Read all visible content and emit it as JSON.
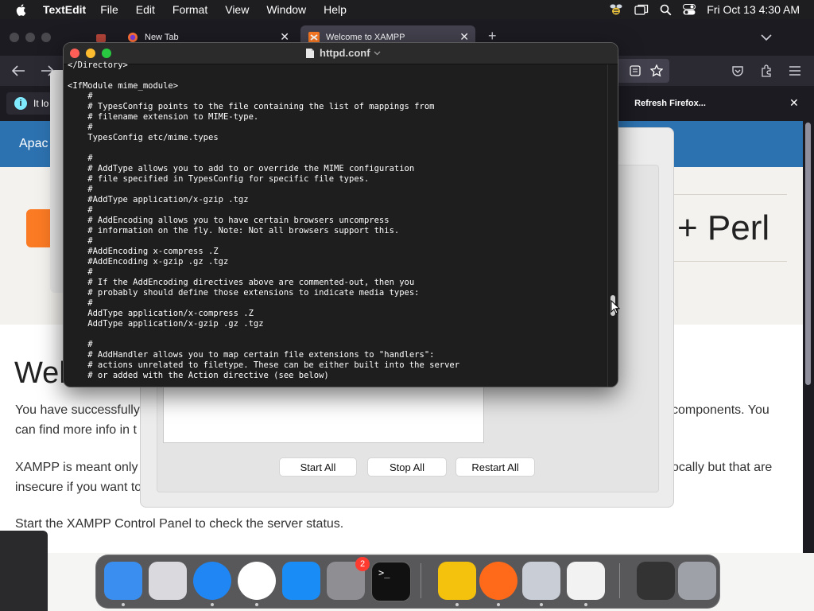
{
  "menubar": {
    "app_name": "TextEdit",
    "items": [
      "File",
      "Edit",
      "Format",
      "View",
      "Window",
      "Help"
    ],
    "clock": "Fri Oct 13  4:30 AM"
  },
  "firefox": {
    "tabs": [
      {
        "label": "New Tab"
      },
      {
        "label": "Welcome to XAMPP"
      }
    ],
    "notification": {
      "text_fragment": "It lo",
      "refresh_button": "Refresh Firefox..."
    },
    "page": {
      "header_brand": "Apac",
      "hero_title_fragment": "+ Perl",
      "welcome_heading": "Wel",
      "para1_left_line1": "You have successfully",
      "para1_left_line2": "can find more info in t",
      "para1_right": "components. You",
      "para2_left_line1": "XAMPP is meant only",
      "para2_left_line2": "insecure if you want to",
      "para2_right": "ocally but that are",
      "para3": "Start the XAMPP Control Panel to check the server status."
    }
  },
  "xampp_panel": {
    "buttons": {
      "start_all": "Start All",
      "stop_all": "Stop All",
      "restart_all": "Restart All"
    }
  },
  "textedit": {
    "title": "httpd.conf",
    "lines": [
      "</Directory>",
      "",
      "<IfModule mime_module>",
      "    #",
      "    # TypesConfig points to the file containing the list of mappings from",
      "    # filename extension to MIME-type.",
      "    #",
      "    TypesConfig etc/mime.types",
      "",
      "    #",
      "    # AddType allows you to add to or override the MIME configuration",
      "    # file specified in TypesConfig for specific file types.",
      "    #",
      "    #AddType application/x-gzip .tgz",
      "    #",
      "    # AddEncoding allows you to have certain browsers uncompress",
      "    # information on the fly. Note: Not all browsers support this.",
      "    #",
      "    #AddEncoding x-compress .Z",
      "    #AddEncoding x-gzip .gz .tgz",
      "    #",
      "    # If the AddEncoding directives above are commented-out, then you",
      "    # probably should define those extensions to indicate media types:",
      "    #",
      "    AddType application/x-compress .Z",
      "    AddType application/x-gzip .gz .tgz",
      "",
      "    #",
      "    # AddHandler allows you to map certain file extensions to \"handlers\":",
      "    # actions unrelated to filetype. These can be either built into the server",
      "    # or added with the Action directive (see below)"
    ]
  },
  "dock": {
    "apps": [
      {
        "name": "Finder",
        "icon": "finder-icon",
        "color": "#3a8ef0"
      },
      {
        "name": "Launchpad",
        "icon": "launchpad-icon",
        "color": "#d9d9de"
      },
      {
        "name": "Safari",
        "icon": "safari-icon",
        "color": "#1f86f3"
      },
      {
        "name": "Chrome",
        "icon": "chrome-icon",
        "color": "#ffffff"
      },
      {
        "name": "App Store",
        "icon": "app-store-icon",
        "color": "#1a8cf6"
      },
      {
        "name": "System Settings",
        "icon": "settings-icon",
        "color": "#8e8e93",
        "badge": "2"
      },
      {
        "name": "Terminal",
        "icon": "terminal-icon",
        "color": "#111111"
      },
      {
        "name": "XAMPP Manager",
        "icon": "xampp-bee-icon",
        "color": "#f4c20d"
      },
      {
        "name": "Firefox",
        "icon": "firefox-icon",
        "color": "#ff6a1a"
      },
      {
        "name": "Gear Utility",
        "icon": "gear-app-icon",
        "color": "#c8cdd6"
      },
      {
        "name": "TextEdit",
        "icon": "textedit-icon",
        "color": "#f2f2f2"
      },
      {
        "name": "Document Preview",
        "icon": "preview-doc-icon",
        "color": "#333333"
      },
      {
        "name": "Trash",
        "icon": "trash-icon",
        "color": "#9ea2a8"
      }
    ]
  }
}
